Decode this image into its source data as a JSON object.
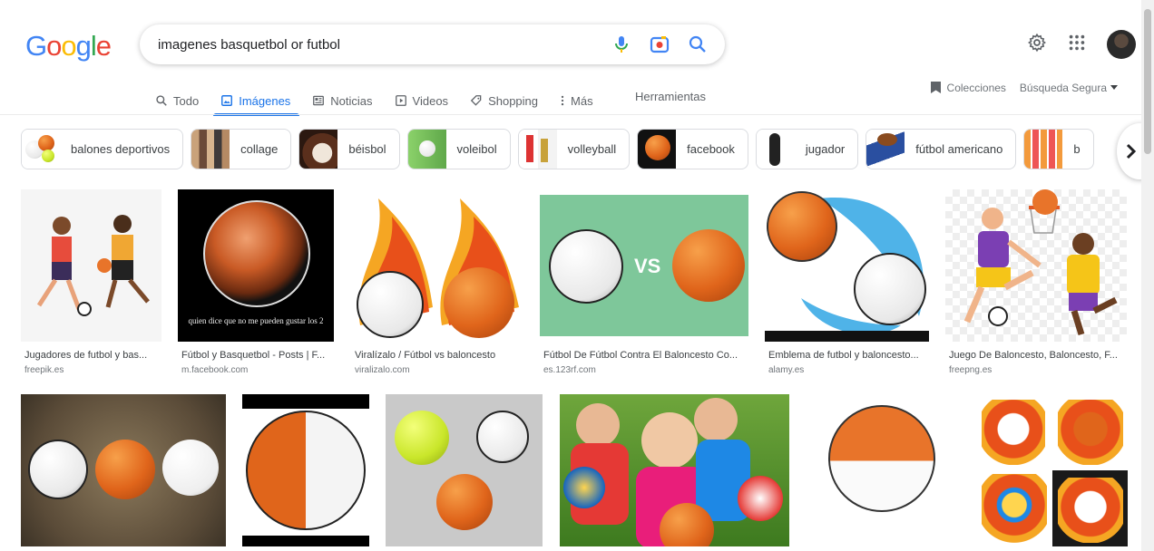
{
  "logo": {
    "g": "G",
    "o1": "o",
    "o2": "o",
    "g2": "g",
    "l": "l",
    "e": "e"
  },
  "search": {
    "value": "imagenes basquetbol or futbol"
  },
  "tabs": [
    {
      "label": "Todo"
    },
    {
      "label": "Imágenes"
    },
    {
      "label": "Noticias"
    },
    {
      "label": "Videos"
    },
    {
      "label": "Shopping"
    },
    {
      "label": "Más"
    }
  ],
  "tools_label": "Herramientas",
  "collections_label": "Colecciones",
  "safesearch_label": "Búsqueda Segura",
  "chips": [
    {
      "label": "balones deportivos"
    },
    {
      "label": "collage"
    },
    {
      "label": "béisbol"
    },
    {
      "label": "voleibol"
    },
    {
      "label": "volleyball"
    },
    {
      "label": "facebook"
    },
    {
      "label": "jugador"
    },
    {
      "label": "fútbol americano"
    },
    {
      "label": "b"
    }
  ],
  "results_row1": [
    {
      "caption": "Jugadores de futbol y bas...",
      "source": "freepik.es"
    },
    {
      "caption": "Fútbol y Basquetbol - Posts | F...",
      "source": "m.facebook.com",
      "overlay_text": "quien dice que no me pueden gustar los 2"
    },
    {
      "caption": "Viralízalo / Fútbol vs baloncesto",
      "source": "viralizalo.com"
    },
    {
      "caption": "Fútbol De Fútbol Contra El Baloncesto Co...",
      "source": "es.123rf.com",
      "overlay_text": "VS"
    },
    {
      "caption": "Emblema de futbol y baloncesto...",
      "source": "alamy.es"
    },
    {
      "caption": "Juego De Baloncesto, Baloncesto, F...",
      "source": "freepng.es"
    }
  ],
  "colors": {
    "accent": "#1a73e8",
    "text": "#202124",
    "muted": "#70757a"
  }
}
